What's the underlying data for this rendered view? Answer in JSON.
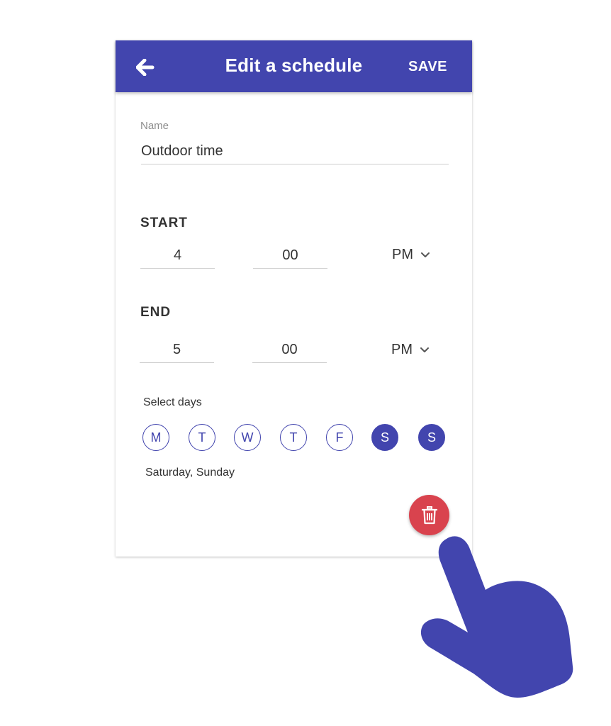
{
  "appbar": {
    "back_icon": "arrow-left-icon",
    "title": "Edit a schedule",
    "save_label": "SAVE",
    "color": "#4245ae"
  },
  "name": {
    "label": "Name",
    "value": "Outdoor time"
  },
  "start": {
    "title": "START",
    "hour": "4",
    "minute": "00",
    "period": "PM"
  },
  "end": {
    "title": "END",
    "hour": "5",
    "minute": "00",
    "period": "PM"
  },
  "days": {
    "label": "Select days",
    "items": [
      {
        "letter": "M",
        "selected": false
      },
      {
        "letter": "T",
        "selected": false
      },
      {
        "letter": "W",
        "selected": false
      },
      {
        "letter": "T",
        "selected": false
      },
      {
        "letter": "F",
        "selected": false
      },
      {
        "letter": "S",
        "selected": true
      },
      {
        "letter": "S",
        "selected": true
      }
    ],
    "summary": "Saturday, Sunday"
  },
  "delete": {
    "icon": "trash-icon",
    "color": "#d9434e"
  },
  "pointer": {
    "icon": "pointing-hand-icon",
    "color": "#4245ae"
  }
}
